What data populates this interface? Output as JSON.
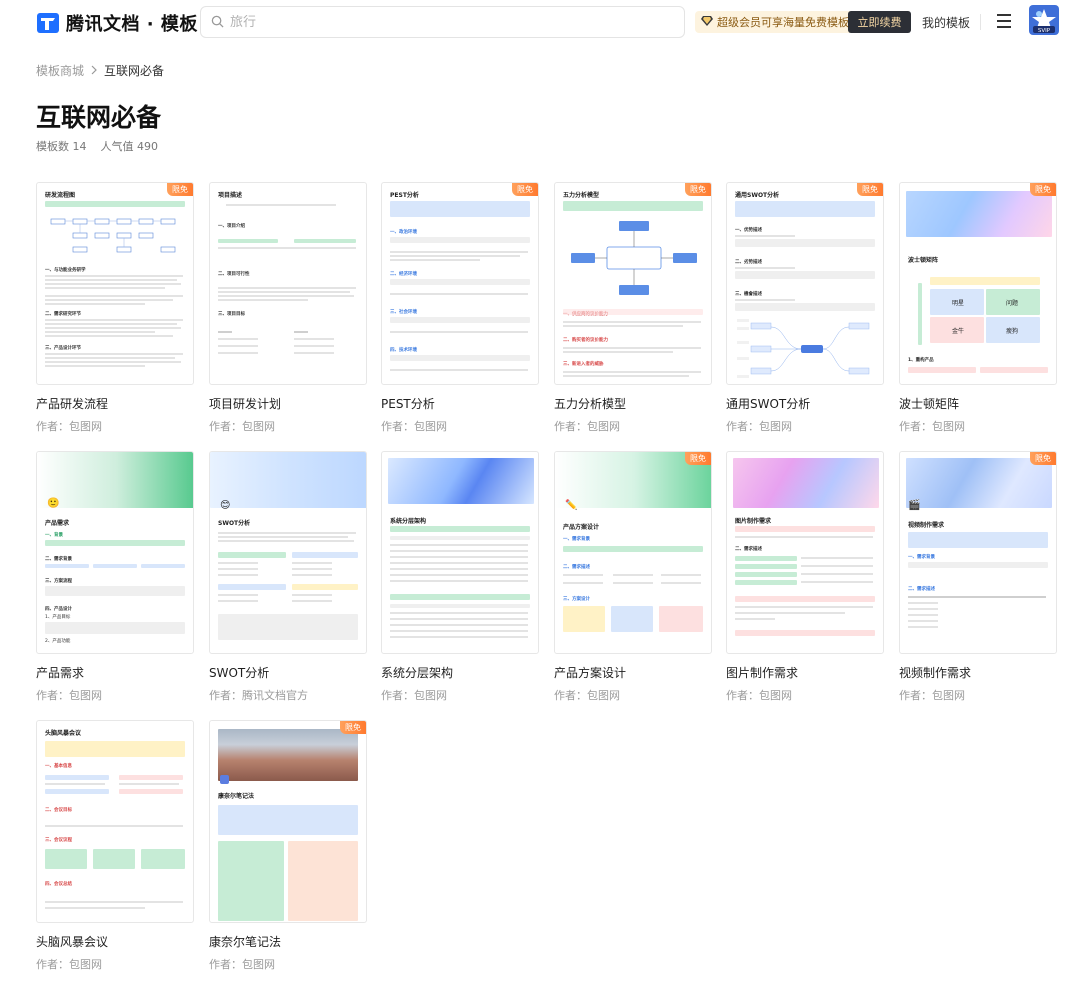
{
  "header": {
    "logo_text": "腾讯文档 · 模板",
    "search_placeholder": "旅行",
    "vip_text": "超级会员可享海量免费模板",
    "renew_label": "立即续费",
    "my_templates_label": "我的模板",
    "avatar_text": "SVIP"
  },
  "breadcrumb": {
    "root": "模板商城",
    "current": "互联网必备"
  },
  "page": {
    "title": "互联网必备",
    "template_count": "模板数 14",
    "popularity": "人气值 490"
  },
  "badge_label": "限免",
  "cards": [
    {
      "title": "产品研发流程",
      "author": "作者：包图网",
      "badge": true,
      "thumb_title": "研发流程图"
    },
    {
      "title": "项目研发计划",
      "author": "作者：包图网",
      "badge": false,
      "thumb_title": "项目描述"
    },
    {
      "title": "PEST分析",
      "author": "作者：包图网",
      "badge": true,
      "thumb_title": "PEST分析"
    },
    {
      "title": "五力分析模型",
      "author": "作者：包图网",
      "badge": true,
      "thumb_title": "五力分析模型"
    },
    {
      "title": "通用SWOT分析",
      "author": "作者：包图网",
      "badge": true,
      "thumb_title": "通用SWOT分析"
    },
    {
      "title": "波士顿矩阵",
      "author": "作者：包图网",
      "badge": true,
      "thumb_title": "波士顿矩阵"
    },
    {
      "title": "产品需求",
      "author": "作者：包图网",
      "badge": false,
      "thumb_title": "产品需求"
    },
    {
      "title": "SWOT分析",
      "author": "作者：腾讯文档官方",
      "badge": false,
      "thumb_title": "SWOT分析"
    },
    {
      "title": "系统分层架构",
      "author": "作者：包图网",
      "badge": false,
      "thumb_title": "系统分层架构"
    },
    {
      "title": "产品方案设计",
      "author": "作者：包图网",
      "badge": true,
      "thumb_title": "产品方案设计"
    },
    {
      "title": "图片制作需求",
      "author": "作者：包图网",
      "badge": false,
      "thumb_title": "图片制作需求"
    },
    {
      "title": "视频制作需求",
      "author": "作者：包图网",
      "badge": true,
      "thumb_title": "视频制作需求"
    },
    {
      "title": "头脑风暴会议",
      "author": "作者：包图网",
      "badge": false,
      "thumb_title": "头脑风暴会议"
    },
    {
      "title": "康奈尔笔记法",
      "author": "作者：包图网",
      "badge": true,
      "thumb_title": "康奈尔笔记法"
    }
  ],
  "boston": {
    "q1": "明星",
    "q2": "问题",
    "q3": "金牛",
    "q4": "瘦狗"
  },
  "colors": {
    "badge": "#ff7a2f",
    "brand_blue": "#1e6fff",
    "renew_bg": "#2c2f36",
    "vip_bg": "#fdf3df"
  }
}
